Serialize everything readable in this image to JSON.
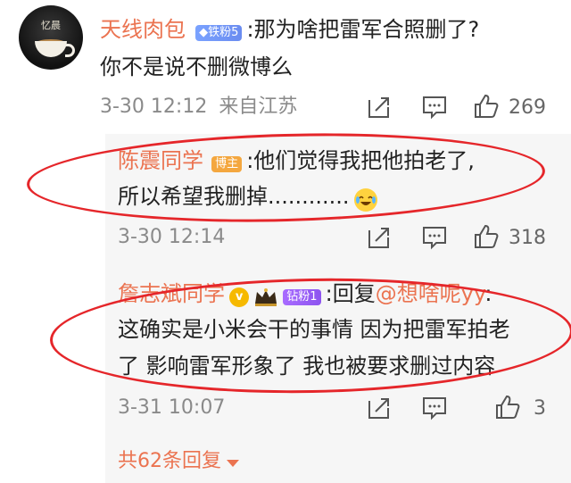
{
  "comment": {
    "avatar_text": "忆晨",
    "username": "天线肉包",
    "badge": "铁粉5",
    "text_line1": ":那为啥把雷军合照删了?",
    "text_line2": "你不是说不删微博么",
    "time": "3-30 12:12",
    "source": "来自江苏",
    "likes": "269"
  },
  "replies": [
    {
      "username": "陈震同学",
      "badge": "博主",
      "text_line1": ":他们觉得我把他拍老了,",
      "text_line2": "所以希望我删掉............",
      "time": "3-30 12:14",
      "likes": "318"
    },
    {
      "username": "詹志斌同学",
      "verified_glyph": "v",
      "badge": "钻粉1",
      "text_line1_prefix": ":回复",
      "mention": "@想啥呢yy",
      "text_line1_suffix": ":",
      "text_line2": "这确实是小米会干的事情 因为把雷军拍老",
      "text_line3": "了 影响雷军形象了 我也被要求删过内容",
      "time": "3-31 10:07",
      "likes": "3"
    }
  ],
  "more_replies": "共62条回复",
  "colors": {
    "username": "#eb7350",
    "annotation": "#e5262a",
    "reply_bg": "#f6f6f6",
    "meta": "#8a8a8a"
  }
}
